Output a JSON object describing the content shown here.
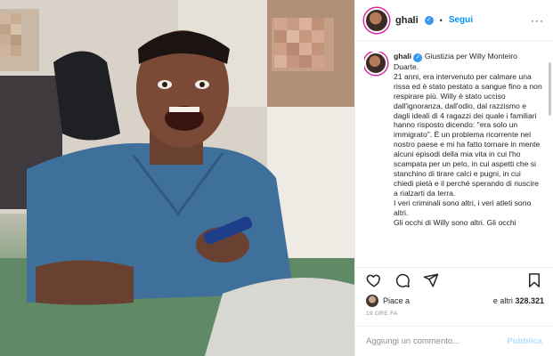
{
  "post": {
    "username": "ghali",
    "verified_glyph": "✓",
    "separator": "•",
    "follow_label": "Segui",
    "more_glyph": "···",
    "caption": {
      "username": "ghali",
      "verified_glyph": "✓",
      "headline": "Giustizia per Willy Monteiro Duarte.",
      "paragraphs": [
        "21 anni, era intervenuto per calmare una rissa ed è stato pestato a sangue fino a non respirare più. Willy è stato ucciso dall'ignoranza, dall'odio, dal razzismo e dagli ideali di 4 ragazzi dei quale i familiari hanno risposto dicendo: \"era solo un immigrato\". È un problema ricorrente nel nostro paese e mi ha fatto tornare in mente alcuni episodi della mia vita in cui l'ho scampata per un pelo, in cui aspetti che si stanchino di tirare calci e pugni, in cui chiedi pietà e il perché sperando di riuscire a rialzarti da terra.",
        "I veri criminali sono altri, i veri atleti sono altri.",
        "Gli occhi di Willy sono altri. Gli occhi"
      ]
    },
    "actions": {
      "like_icon": "heart-icon",
      "comment_icon": "comment-icon",
      "share_icon": "share-icon",
      "save_icon": "bookmark-icon"
    },
    "likes": {
      "prefix": "Piace a",
      "suffix": "e altri",
      "count": "328.321"
    },
    "timestamp": "19 ORE FA",
    "comment": {
      "placeholder": "Aggiungi un commento...",
      "publish_label": "Pubblica"
    }
  },
  "colors": {
    "accent": "#0095f6",
    "verified": "#3897f0",
    "publish_disabled": "#b2dffc",
    "text": "#262626",
    "muted": "#8e8e8e"
  }
}
